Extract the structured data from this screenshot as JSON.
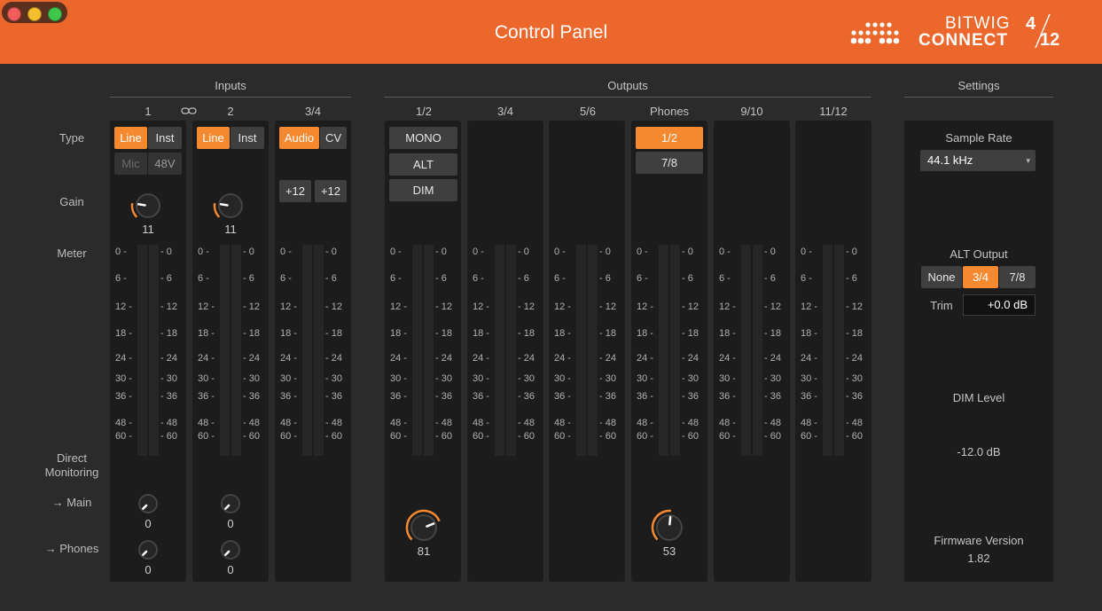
{
  "window": {
    "title": "Control Panel"
  },
  "brand": {
    "line1": "BITWIG",
    "line2": "CONNECT",
    "model_num": "4",
    "model_den": "12"
  },
  "sections": {
    "inputs": "Inputs",
    "outputs": "Outputs",
    "settings": "Settings"
  },
  "row_labels": {
    "type": "Type",
    "gain": "Gain",
    "meter": "Meter",
    "direct1": "Direct",
    "direct2": "Monitoring",
    "main": "→ Main",
    "phones": "→ Phones"
  },
  "inputs": [
    {
      "label": "1",
      "type_buttons": [
        "Line",
        "Inst"
      ],
      "type_active": 0,
      "extra_buttons": [
        "Mic",
        "48V"
      ],
      "gain": "11",
      "main": "0",
      "phones": "0"
    },
    {
      "label": "2",
      "type_buttons": [
        "Line",
        "Inst"
      ],
      "type_active": 0,
      "gain": "11",
      "main": "0",
      "phones": "0"
    },
    {
      "label": "3/4",
      "type_buttons": [
        "Audio",
        "CV"
      ],
      "type_active": 0,
      "level_buttons": [
        "+12",
        "+12"
      ]
    }
  ],
  "outputs": [
    {
      "label": "1/2",
      "buttons": [
        "MONO",
        "ALT",
        "DIM"
      ],
      "volume": "81"
    },
    {
      "label": "3/4"
    },
    {
      "label": "5/6"
    },
    {
      "label": "Phones",
      "buttons": [
        "1/2",
        "7/8"
      ],
      "active": 0,
      "volume": "53"
    },
    {
      "label": "9/10"
    },
    {
      "label": "11/12"
    }
  ],
  "meter_scale": [
    "0",
    "6",
    "12",
    "18",
    "24",
    "30",
    "36",
    "48",
    "60"
  ],
  "settings": {
    "sample_rate_label": "Sample Rate",
    "sample_rate_value": "44.1 kHz",
    "alt_output_label": "ALT Output",
    "alt_options": [
      "None",
      "3/4",
      "7/8"
    ],
    "alt_active": 1,
    "trim_label": "Trim",
    "trim_value": "+0.0 dB",
    "dim_label": "DIM Level",
    "dim_value": "-12.0 dB",
    "firmware_label": "Firmware Version",
    "firmware_value": "1.82"
  },
  "colors": {
    "accent": "#ec672b",
    "active_button": "#f5892f",
    "background": "#2b2b2b",
    "strip": "#1c1c1c"
  }
}
